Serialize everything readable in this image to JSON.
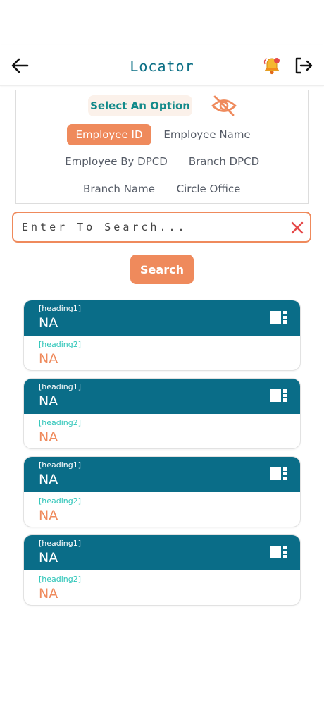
{
  "header": {
    "title": "Locator"
  },
  "options": {
    "prompt": "Select An Option",
    "items": [
      "Employee ID",
      "Employee Name",
      "Employee By DPCD",
      "Branch DPCD",
      "Branch Name",
      "Circle Office"
    ],
    "selected": "Employee ID"
  },
  "search": {
    "placeholder": "Enter To Search...",
    "value": "",
    "button_label": "Search"
  },
  "cards": [
    {
      "heading1_label": "[heading1]",
      "heading1_value": "NA",
      "heading2_label": "[heading2]",
      "heading2_value": "NA"
    },
    {
      "heading1_label": "[heading1]",
      "heading1_value": "NA",
      "heading2_label": "[heading2]",
      "heading2_value": "NA"
    },
    {
      "heading1_label": "[heading1]",
      "heading1_value": "NA",
      "heading2_label": "[heading2]",
      "heading2_value": "NA"
    },
    {
      "heading1_label": "[heading1]",
      "heading1_value": "NA",
      "heading2_label": "[heading2]",
      "heading2_value": "NA"
    }
  ],
  "icons": {
    "back": "arrow-left-icon",
    "notification": "bell-icon",
    "logout": "logout-icon",
    "visibility": "eye-off-icon",
    "clear": "close-icon",
    "card_action": "contact-card-icon"
  },
  "colors": {
    "primary": "#0a6d88",
    "accent": "#ef8a5c",
    "teal_text": "#138a8a",
    "heading2_label": "#2cc5b8",
    "pill_bg": "#fbf1ea"
  }
}
